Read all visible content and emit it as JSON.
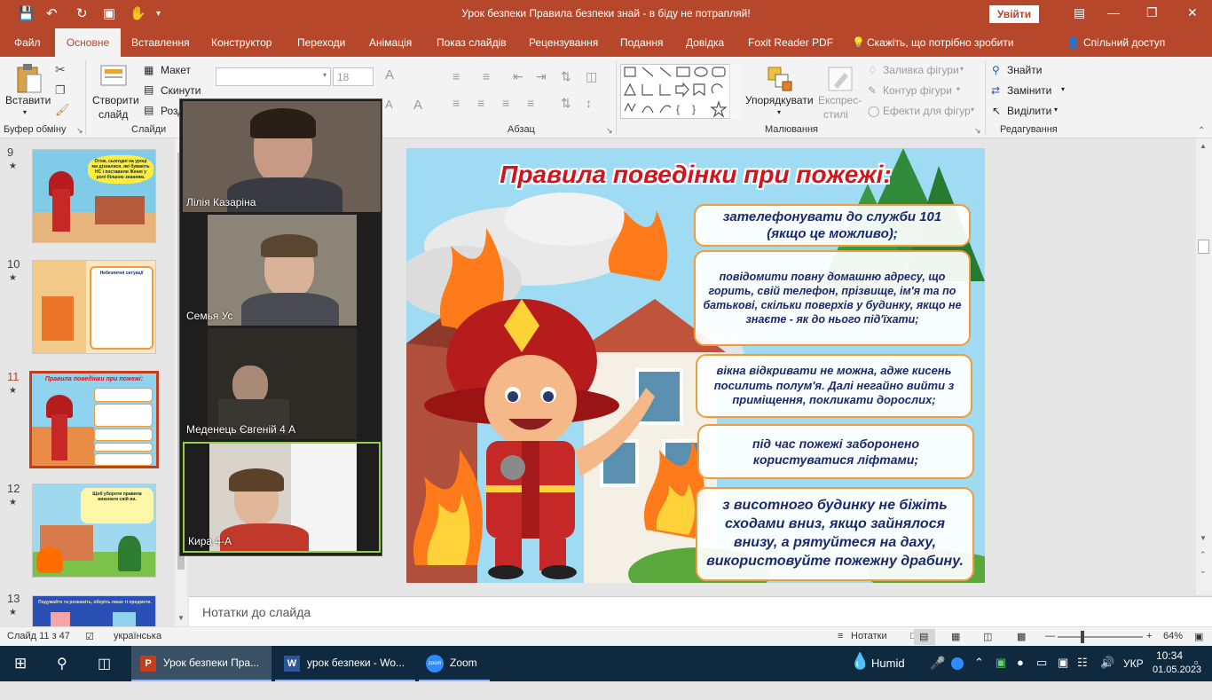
{
  "window": {
    "title": "Урок безпеки Правила безпеки знай - в біду не потрапляй!",
    "signin": "Увійти"
  },
  "tabs": {
    "file": "Файл",
    "home": "Основне",
    "insert": "Вставлення",
    "design": "Конструктор",
    "transitions": "Переходи",
    "animation": "Анімація",
    "slideshow": "Показ слайдів",
    "review": "Рецензування",
    "view": "Подання",
    "help": "Довідка",
    "foxit": "Foxit Reader PDF",
    "tellme": "Скажіть, що потрібно зробити",
    "share": "Спільний доступ"
  },
  "ribbon": {
    "paste": "Вставити",
    "clipboard_group": "Буфер обміну",
    "new_slide_line1": "Створити",
    "new_slide_line2": "слайд",
    "layout": "Макет",
    "reset": "Скинути",
    "section": "Розд",
    "slides_group": "Слайди",
    "font_size": "18",
    "paragraph_group": "Абзац",
    "arrange": "Упорядкувати",
    "quick_styles_line1": "Експрес-",
    "quick_styles_line2": "стилі",
    "shape_fill": "Заливка фігури",
    "shape_outline": "Контур фігури",
    "shape_effects": "Ефекти для фігур",
    "drawing_group": "Малювання",
    "find": "Знайти",
    "replace": "Замінити",
    "select": "Виділити",
    "editing_group": "Редагування"
  },
  "thumbnails": [
    {
      "num": "9",
      "text": "Отож, сьогодні на уроці ми дізналися, які бувають НС і поставили Женю у ролі білшою знанням."
    },
    {
      "num": "10",
      "text": "Небезпечні ситуації"
    },
    {
      "num": "11",
      "text": "Правила поведінки при пожежі:"
    },
    {
      "num": "12",
      "text": "Щоб убороти правила виконати свій ви."
    },
    {
      "num": "13",
      "text": "Подумайте та розкажіть, оберіть лише ті предмети."
    }
  ],
  "slide": {
    "title": "Правила поведінки при пожежі:",
    "rules": [
      "зателефонувати до служби 101 (якщо це можливо);",
      "повідомити повну домашню адресу, що горить, свій телефон, прізвище, ім'я та по батькові, скільки поверхів у будинку, якщо не знаєте - як до нього під'їхати;",
      "вікна відкривати не можна, адже кисень посилить полум'я. Далі  негайно вийти з приміщення, покликати дорослих;",
      "під час пожежі заборонено користуватися ліфтами;",
      "з висотного будинку не біжіть сходами вниз, якщо зайнялося внизу, а рятуйтеся на даху, використовуйте пожежну драбину."
    ]
  },
  "zoom_participants": [
    "Лілія Казаріна",
    "Семья Ус",
    "Меденець Євгеній 4 А",
    "Кира 4-А"
  ],
  "notes_placeholder": "Нотатки до слайда",
  "status": {
    "slide_counter": "Слайд 11 з 47",
    "language": "українська",
    "notes_btn": "Нотатки",
    "zoom": "64%"
  },
  "taskbar": {
    "ppt": "Урок безпеки Пра...",
    "word": "урок безпеки - Wo...",
    "zoom": "Zoom",
    "weather": "Humid",
    "lang": "УКР",
    "time": "10:34",
    "date": "01.05.2023"
  },
  "colors": {
    "accent": "#b7472a",
    "taskbar": "#0f2a3f",
    "slide_title": "#d4141c",
    "rule_text": "#1a2a6c"
  }
}
